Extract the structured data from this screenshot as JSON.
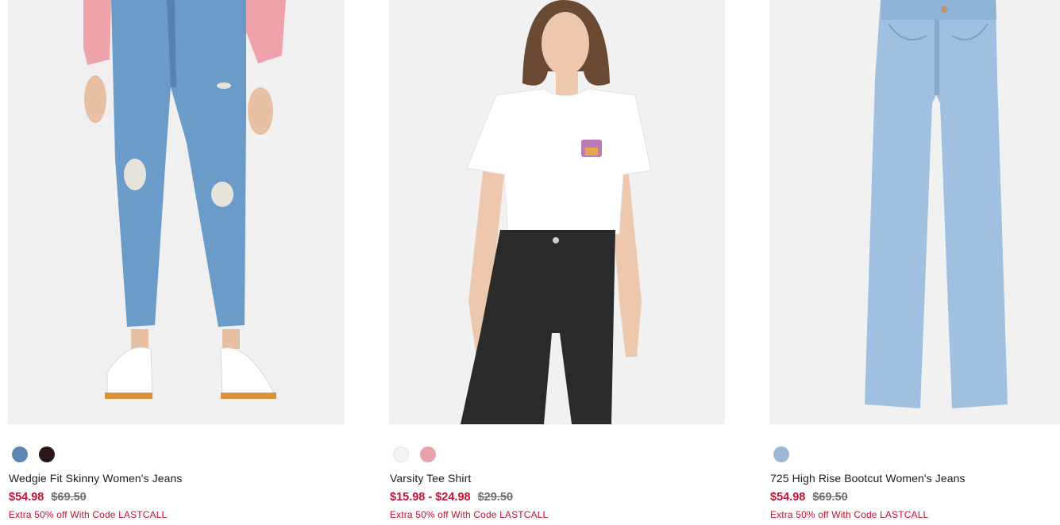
{
  "products": [
    {
      "name": "Wedgie Fit Skinny Women's Jeans",
      "sale_price": "$54.98",
      "original_price": "$69.50",
      "promo": "Extra 50% off With Code LASTCALL",
      "swatches": [
        "#5e86b3",
        "#2b1717"
      ]
    },
    {
      "name": "Varsity Tee Shirt",
      "sale_price": "$15.98 - $24.98",
      "original_price": "$29.50",
      "promo": "Extra 50% off With Code LASTCALL",
      "swatches": [
        "#f4f4f4",
        "#e8a2aa"
      ]
    },
    {
      "name": "725 High Rise Bootcut Women's Jeans",
      "sale_price": "$54.98",
      "original_price": "$69.50",
      "promo": "Extra 50% off With Code LASTCALL",
      "swatches": [
        "#9bb7d6"
      ]
    }
  ],
  "colors": {
    "sale": "#c41230",
    "original": "#707070",
    "image_bg": "#f1f1f1"
  }
}
